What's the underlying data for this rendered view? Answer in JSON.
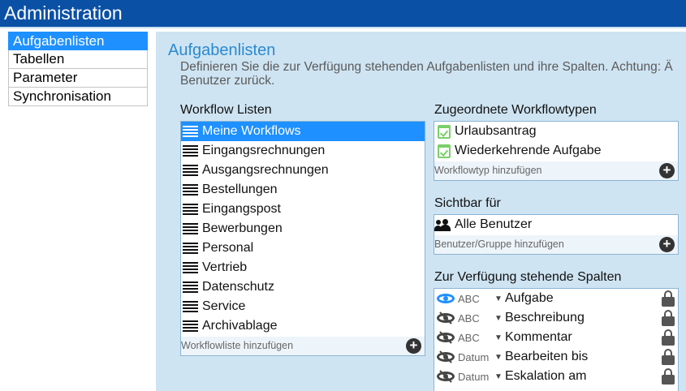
{
  "header": {
    "title": "Administration"
  },
  "sidebar": {
    "items": [
      {
        "label": "Aufgabenlisten",
        "active": true
      },
      {
        "label": "Tabellen",
        "active": false
      },
      {
        "label": "Parameter",
        "active": false
      },
      {
        "label": "Synchronisation",
        "active": false
      }
    ]
  },
  "main": {
    "title": "Aufgabenlisten",
    "description_line1": "Definieren Sie die zur Verfügung stehenden Aufgabenlisten und ihre Spalten. Achtung: Ä",
    "description_line2": "Benutzer zurück."
  },
  "workflow_lists": {
    "label": "Workflow Listen",
    "items": [
      "Meine Workflows",
      "Eingangsrechnungen",
      "Ausgangsrechnungen",
      "Bestellungen",
      "Eingangspost",
      "Bewerbungen",
      "Personal",
      "Vertrieb",
      "Datenschutz",
      "Service",
      "Archivablage"
    ],
    "selected_index": 0,
    "add_label": "Workflowliste hinzufügen",
    "icon": "list-lines-icon"
  },
  "workflow_types": {
    "label": "Zugeordnete Workflowtypen",
    "items": [
      "Urlaubsantrag",
      "Wiederkehrende Aufgabe"
    ],
    "add_label": "Workflowtyp hinzufügen",
    "icon": "calendar-check-icon",
    "icon_color": "#7bcf6a"
  },
  "visibility": {
    "label": "Sichtbar für",
    "items": [
      "Alle Benutzer"
    ],
    "add_label": "Benutzer/Gruppe hinzufügen",
    "icon": "users-icon"
  },
  "columns": {
    "label": "Zur Verfügung stehende Spalten",
    "items": [
      {
        "visible": true,
        "type": "ABC",
        "name": "Aufgabe"
      },
      {
        "visible": false,
        "type": "ABC",
        "name": "Beschreibung"
      },
      {
        "visible": false,
        "type": "ABC",
        "name": "Kommentar"
      },
      {
        "visible": false,
        "type": "Datum",
        "name": "Bearbeiten bis"
      },
      {
        "visible": false,
        "type": "Datum",
        "name": "Eskalation am"
      }
    ]
  },
  "colors": {
    "header_bg": "#0a50a5",
    "accent": "#1e90ff",
    "panel_bg": "#cfe4f2",
    "title_blue": "#2a8ad0"
  }
}
